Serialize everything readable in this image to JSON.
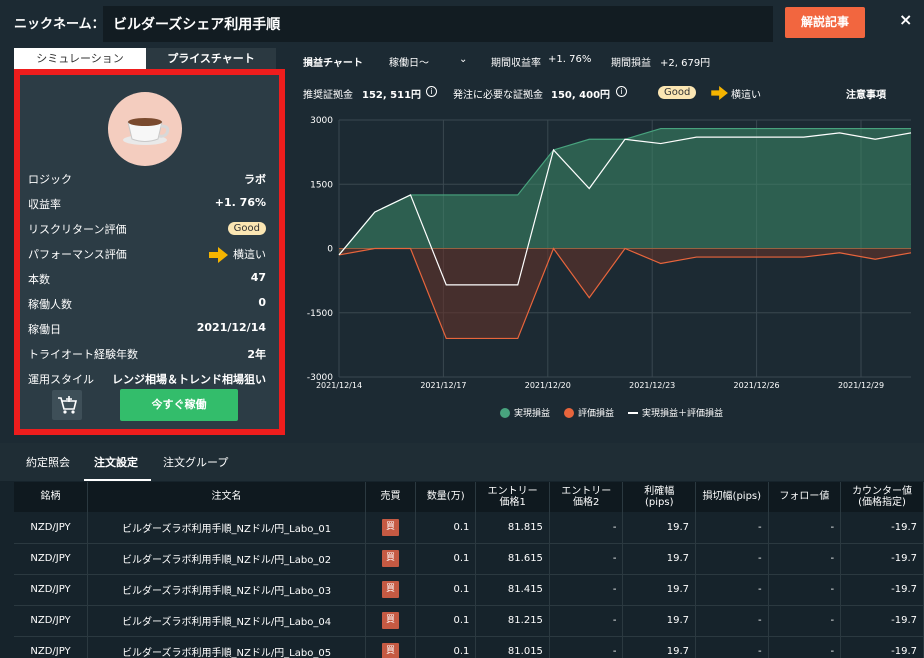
{
  "header": {
    "nickname_label": "ニックネーム：",
    "nickname_value": "ビルダーズシェア利用手順",
    "explain_button": "解説記事",
    "close_label": "×"
  },
  "left_tabs": {
    "simulation": "シミュレーション",
    "price_chart": "プライスチャート"
  },
  "strategy": {
    "rows": [
      {
        "label": "ロジック",
        "value": "ラボ"
      },
      {
        "label": "収益率",
        "value": "+1. 76%"
      },
      {
        "label": "リスクリターン評価",
        "value": "Good"
      },
      {
        "label": "パフォーマンス評価",
        "value": "横這い"
      },
      {
        "label": "本数",
        "value": "47"
      },
      {
        "label": "稼働人数",
        "value": "0"
      },
      {
        "label": "稼働日",
        "value": "2021/12/14"
      },
      {
        "label": "トライオート経験年数",
        "value": "2年"
      },
      {
        "label": "運用スタイル",
        "value": "レンジ相場＆トレンド相場狙い"
      }
    ],
    "run_button": "今すぐ稼働"
  },
  "chart_header": {
    "title": "損益チャート",
    "period_label": "稼働日〜",
    "period_return_label": "期間収益率",
    "period_return_value": "+1. 76%",
    "period_pl_label": "期間損益",
    "period_pl_value": "+2, 679円"
  },
  "info_row": {
    "recommended_label": "推奨証拠金",
    "recommended_value": "152, 511円",
    "required_label": "発注に必要な証拠金",
    "required_value": "150, 400円",
    "rating_badge": "Good",
    "performance_text": "横這い",
    "notes_link": "注意事項"
  },
  "chart_data": {
    "type": "area",
    "x_tick_labels": [
      "2021/12/14",
      "2021/12/17",
      "2021/12/20",
      "2021/12/23",
      "2021/12/26",
      "2021/12/29"
    ],
    "y_tick_labels": [
      "3000",
      "1500",
      "0",
      "-1500",
      "-3000"
    ],
    "ylim": [
      -3000,
      3000
    ],
    "x": [
      0,
      1,
      2,
      3,
      4,
      5,
      6,
      7,
      8,
      9,
      10,
      11,
      12,
      13,
      14,
      15,
      16
    ],
    "series": [
      {
        "name": "実現損益",
        "color": "#48a37e",
        "values": [
          -150,
          850,
          1250,
          1250,
          1250,
          1250,
          2300,
          2550,
          2550,
          2800,
          2800,
          2800,
          2800,
          2800,
          2800,
          2800,
          2800
        ]
      },
      {
        "name": "評価損益",
        "color": "#e8653c",
        "values": [
          -150,
          0,
          0,
          -2100,
          -2100,
          -2100,
          0,
          -1150,
          0,
          -350,
          -200,
          -200,
          -200,
          -200,
          -100,
          -250,
          -100
        ]
      },
      {
        "name": "実現損益＋評価損益",
        "color": "#ffffff",
        "values": [
          -150,
          850,
          1250,
          -850,
          -850,
          -850,
          2300,
          1400,
          2550,
          2450,
          2600,
          2600,
          2600,
          2600,
          2700,
          2550,
          2700
        ]
      }
    ],
    "grid": true
  },
  "legend": {
    "realized": "実現損益",
    "unrealized": "評価損益",
    "combined": "実現損益＋評価損益"
  },
  "bottom_tabs": {
    "agreement": "約定照会",
    "order_settings": "注文設定",
    "order_group": "注文グループ"
  },
  "table": {
    "headers": [
      "銘柄",
      "注文名",
      "売買",
      "数量(万)",
      "エントリー\n価格1",
      "エントリー\n価格2",
      "利確幅\n(pips)",
      "損切幅(pips)",
      "フォロー値",
      "カウンター値\n(価格指定)"
    ],
    "rows": [
      {
        "pair": "NZD/JPY",
        "name": "ビルダーズラボ利用手順_NZドル/円_Labo_01",
        "side": "買",
        "qty": "0.1",
        "entry1": "81.815",
        "entry2": "-",
        "tp": "19.7",
        "sl": "-",
        "follow": "-",
        "counter": "-19.7"
      },
      {
        "pair": "NZD/JPY",
        "name": "ビルダーズラボ利用手順_NZドル/円_Labo_02",
        "side": "買",
        "qty": "0.1",
        "entry1": "81.615",
        "entry2": "-",
        "tp": "19.7",
        "sl": "-",
        "follow": "-",
        "counter": "-19.7"
      },
      {
        "pair": "NZD/JPY",
        "name": "ビルダーズラボ利用手順_NZドル/円_Labo_03",
        "side": "買",
        "qty": "0.1",
        "entry1": "81.415",
        "entry2": "-",
        "tp": "19.7",
        "sl": "-",
        "follow": "-",
        "counter": "-19.7"
      },
      {
        "pair": "NZD/JPY",
        "name": "ビルダーズラボ利用手順_NZドル/円_Labo_04",
        "side": "買",
        "qty": "0.1",
        "entry1": "81.215",
        "entry2": "-",
        "tp": "19.7",
        "sl": "-",
        "follow": "-",
        "counter": "-19.7"
      },
      {
        "pair": "NZD/JPY",
        "name": "ビルダーズラボ利用手順_NZドル/円_Labo_05",
        "side": "買",
        "qty": "0.1",
        "entry1": "81.015",
        "entry2": "-",
        "tp": "19.7",
        "sl": "-",
        "follow": "-",
        "counter": "-19.7"
      }
    ]
  },
  "icons": {
    "avatar": "coffee-cup-icon",
    "arrow": "right-arrow-icon",
    "cart": "cart-icon",
    "info": "info-icon",
    "dropdown": "chevron-down-icon"
  }
}
